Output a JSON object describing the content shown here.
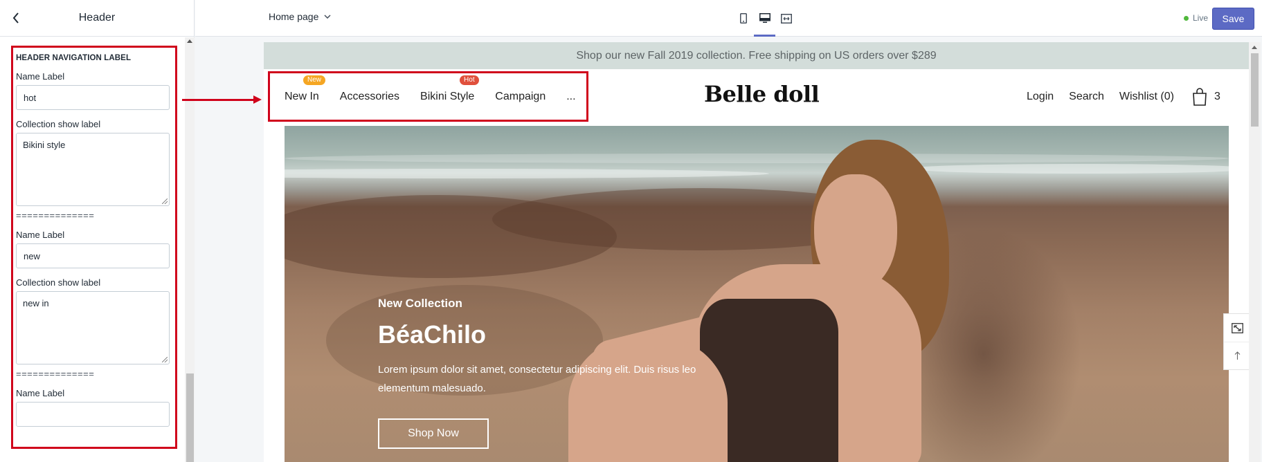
{
  "sidebar": {
    "title": "Header",
    "section_title": "HEADER NAVIGATION LABEL",
    "separator": "==============",
    "groups": [
      {
        "name_label": "Name Label",
        "name_value": "hot",
        "collection_label": "Collection show label",
        "collection_value": "Bikini style"
      },
      {
        "name_label": "Name Label",
        "name_value": "new",
        "collection_label": "Collection show label",
        "collection_value": "new in"
      },
      {
        "name_label": "Name Label",
        "name_value": ""
      }
    ]
  },
  "topbar": {
    "page_select": "Home page",
    "live_label": "Live",
    "save_label": "Save"
  },
  "store": {
    "announcement": "Shop our new Fall 2019 collection. Free shipping on US orders over $289",
    "nav": [
      {
        "label": "New In",
        "badge": "New"
      },
      {
        "label": "Accessories"
      },
      {
        "label": "Bikini Style",
        "badge": "Hot"
      },
      {
        "label": "Campaign"
      },
      {
        "label": "..."
      }
    ],
    "logo": "Belle doll",
    "login": "Login",
    "search": "Search",
    "wishlist": "Wishlist (0)",
    "cart_count": "3",
    "hero": {
      "kicker": "New Collection",
      "title": "BéaChilo",
      "description": "Lorem ipsum dolor sit amet, consectetur adipiscing elit. Duis risus leo elementum malesuado.",
      "button": "Shop Now"
    }
  },
  "colors": {
    "accent": "#5c6ac4",
    "highlight_border": "#d0021b",
    "badge_new": "#f5a623",
    "badge_hot": "#e0503c",
    "live_dot": "#50b83c",
    "announcement_bg": "#d3ddda"
  },
  "icons": [
    "chevron-left-icon",
    "chevron-down-icon",
    "mobile-view-icon",
    "desktop-view-icon",
    "fullwidth-view-icon",
    "cart-bag-icon",
    "expand-icon",
    "arrow-up-icon"
  ]
}
